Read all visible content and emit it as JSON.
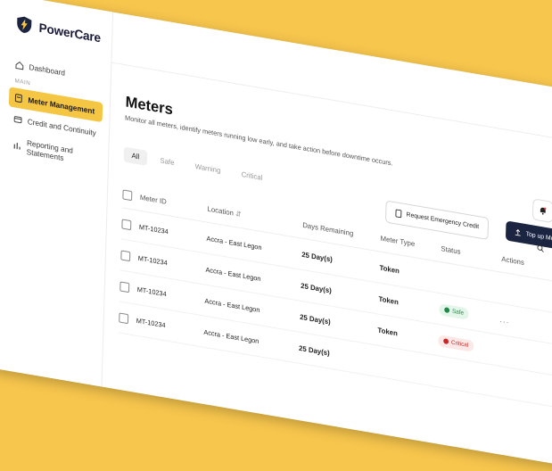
{
  "app": {
    "name": "PowerCare"
  },
  "sidebar": {
    "section_label": "MAIN",
    "items": [
      {
        "label": "Dashboard"
      },
      {
        "label": "Meter Management"
      },
      {
        "label": "Credit and Continuity"
      },
      {
        "label": "Reporting and Statements"
      }
    ]
  },
  "page": {
    "title": "Meters",
    "subtitle": "Monitor all meters, identify meters running low early, and take action before downtime occurs."
  },
  "tabs": [
    {
      "label": "All"
    },
    {
      "label": "Safe"
    },
    {
      "label": "Warning"
    },
    {
      "label": "Critical"
    }
  ],
  "actions": {
    "request_credit": "Request Emergency Credit",
    "top_up": "Top up Meter"
  },
  "table": {
    "headers": {
      "meter_id": "Meter ID",
      "location": "Location",
      "days_remaining": "Days Remaining",
      "meter_type": "Meter Type",
      "status": "Status",
      "actions": "Actions"
    },
    "rows": [
      {
        "meter_id": "MT-10234",
        "location": "Accra - East Legon",
        "days": "25 Day(s)",
        "type": "Token",
        "status": "",
        "status_kind": "none"
      },
      {
        "meter_id": "MT-10234",
        "location": "Accra - East Legon",
        "days": "25 Day(s)",
        "type": "Token",
        "status": "Safe",
        "status_kind": "safe"
      },
      {
        "meter_id": "MT-10234",
        "location": "Accra - East Legon",
        "days": "25 Day(s)",
        "type": "Token",
        "status": "Critical",
        "status_kind": "critical"
      },
      {
        "meter_id": "MT-10234",
        "location": "Accra - East Legon",
        "days": "25 Day(s)",
        "type": "",
        "status": "",
        "status_kind": "none"
      }
    ],
    "actions_glyph": "..."
  },
  "colors": {
    "accent": "#f5c644",
    "primary": "#1b2440",
    "safe": "#1d8a45",
    "critical": "#c62828"
  }
}
